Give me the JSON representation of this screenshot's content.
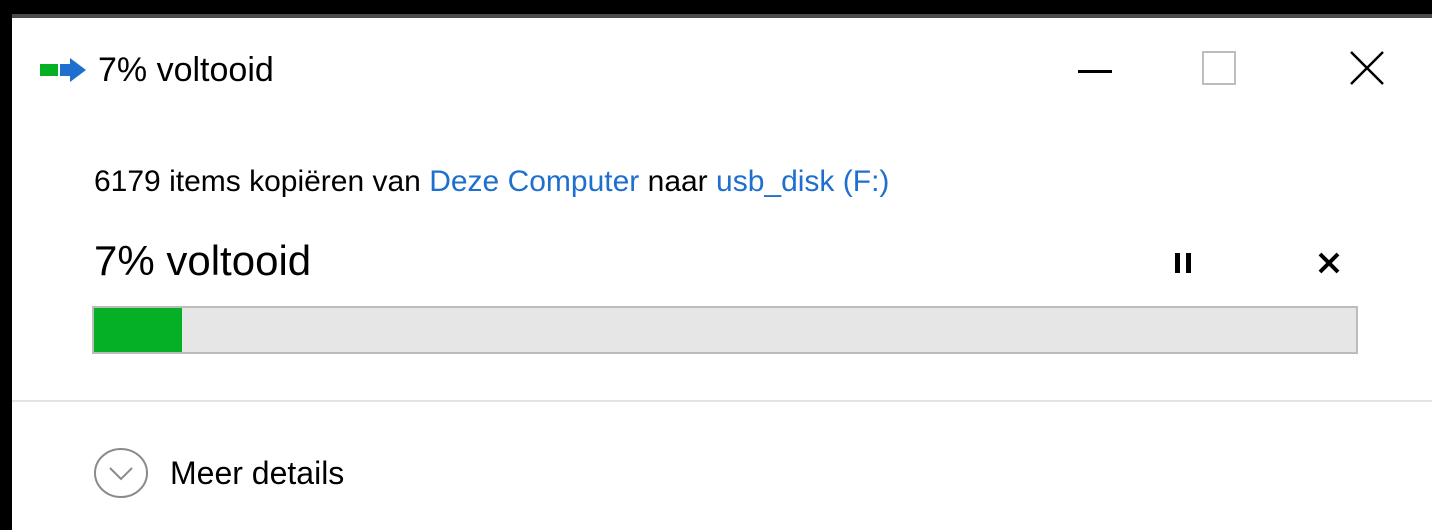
{
  "window": {
    "title": "7% voltooid",
    "icon": "file-copy-icon"
  },
  "controls": {
    "minimize": "minimize-icon",
    "maximize": "maximize-icon",
    "close": "close-icon"
  },
  "operation": {
    "prefix": "6179 items kopiëren van ",
    "source": "Deze Computer",
    "middle": " naar ",
    "destination": "usb_disk (F:)",
    "status": "7% voltooid",
    "progress_percent": 7,
    "pause_icon": "pause-icon",
    "cancel_icon": "cancel-icon"
  },
  "details": {
    "label": "Meer details",
    "icon": "chevron-down-circle-icon"
  },
  "colors": {
    "progress": "#06b025",
    "link": "#1e6fce",
    "track": "#e6e6e6"
  }
}
